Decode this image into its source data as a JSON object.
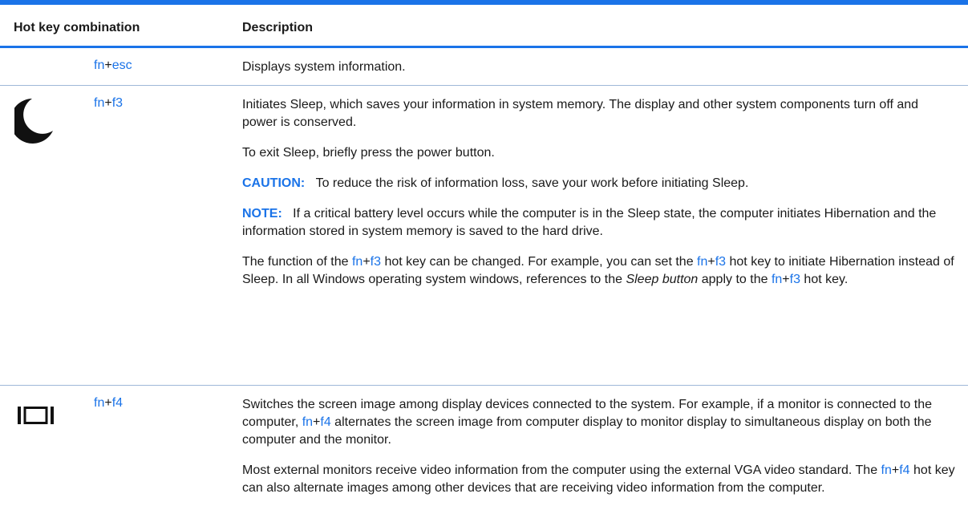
{
  "header": {
    "col1": "Hot key combination",
    "col2": "Description"
  },
  "rows": [
    {
      "icon": "none",
      "key_fn": "fn",
      "key_plus": "+",
      "key_other": "esc",
      "desc": [
        "Displays system information."
      ]
    },
    {
      "icon": "moon-icon",
      "key_fn": "fn",
      "key_plus": "+",
      "key_other": "f3",
      "p1": "Initiates Sleep, which saves your information in system memory. The display and other system components turn off and power is conserved.",
      "p2": "To exit Sleep, briefly press the power button.",
      "caution_label": "CAUTION:",
      "caution_text": "To reduce the risk of information loss, save your work before initiating Sleep.",
      "note_label": "NOTE:",
      "note_text": "If a critical battery level occurs while the computer is in the Sleep state, the computer initiates Hibernation and the information stored in system memory is saved to the hard drive.",
      "p5_a": "The function of the ",
      "p5_fn1": "fn",
      "p5_plus1": "+",
      "p5_f3a": "f3",
      "p5_b": " hot key can be changed. For example, you can set the ",
      "p5_fn2": "fn",
      "p5_plus2": "+",
      "p5_f3b": "f3",
      "p5_c": " hot key to initiate Hibernation instead of Sleep. In all Windows operating system windows, references to the ",
      "p5_italic": "Sleep button",
      "p5_d": " apply to the ",
      "p5_fn3": "fn",
      "p5_plus3": "+",
      "p5_f3c": "f3",
      "p5_e": " hot key."
    },
    {
      "icon": "display-switch-icon",
      "key_fn": "fn",
      "key_plus": "+",
      "key_other": "f4",
      "p1_a": "Switches the screen image among display devices connected to the system. For example, if a monitor is connected to the computer, ",
      "p1_fn": "fn",
      "p1_plus": "+",
      "p1_f4": "f4",
      "p1_b": " alternates the screen image from computer display to monitor display to simultaneous display on both the computer and the monitor.",
      "p2_a": "Most external monitors receive video information from the computer using the external VGA video standard. The ",
      "p2_fn": "fn",
      "p2_plus": "+",
      "p2_f4": "f4",
      "p2_b": " hot key can also alternate images among other devices that are receiving video information from the computer."
    }
  ],
  "colors": {
    "accent": "#1a73e8",
    "text": "#1a1a1a",
    "row_rule": "#9fb8d8"
  }
}
